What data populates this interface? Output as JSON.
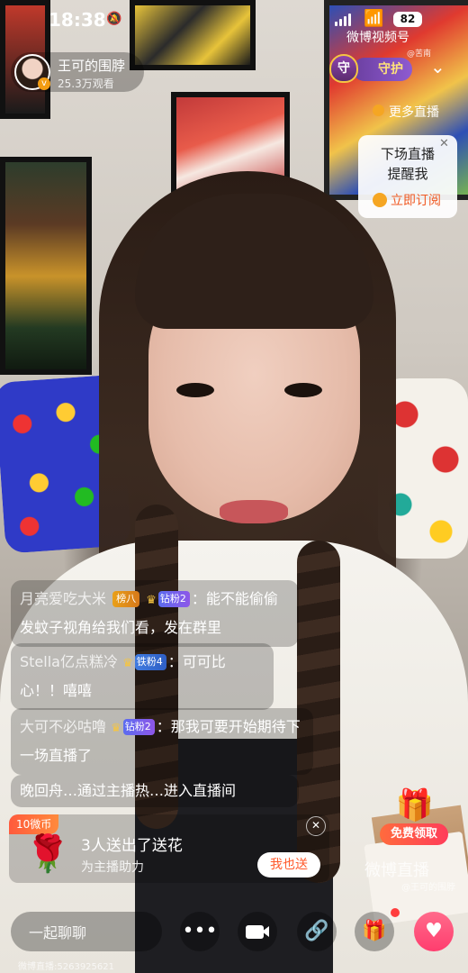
{
  "status_bar": {
    "time": "18:38",
    "battery": "82",
    "watermark": "微博视频号",
    "watermark_sub": "@苦南"
  },
  "host": {
    "name": "王可的围脖",
    "views": "25.3万观看"
  },
  "guard": {
    "label": "守护"
  },
  "more_live": {
    "label": "更多直播"
  },
  "reminder": {
    "line1": "下场直播",
    "line2": "提醒我",
    "subscribe_label": "立即订阅"
  },
  "comments": [
    {
      "user": "月亮爱吃大米",
      "rank_badge": "榜八",
      "fan_badge": "钻粉2",
      "text": "能不能偷偷发蚊子视角给我们看，发在群里"
    },
    {
      "user": "Stella亿点糕冷",
      "fan_badge": "铁粉4",
      "text": "可可比心！！嘻嘻"
    },
    {
      "user": "大可不必咕噜",
      "fan_badge": "钻粉2",
      "text": "那我可要开始期待下一场直播了"
    }
  ],
  "entry_notice": "晚回舟…通过主播热…进入直播间",
  "gift_notice": {
    "tag": "10微币",
    "title": "3人送出了送花",
    "subtitle": "为主播助力",
    "button": "我也送"
  },
  "free_gift": {
    "button": "免费领取"
  },
  "bottom_watermark": {
    "title": "微博直播",
    "sub": "@王可的围脖"
  },
  "bottom_bar": {
    "chat_placeholder": "一起聊聊",
    "footer_id": "微博直播:5263925621"
  },
  "icons": [
    "bell-mute-icon",
    "wifi-icon",
    "signal-icon",
    "verified-icon",
    "chevron-down-icon",
    "planet-icon",
    "close-icon",
    "clock-icon",
    "crown-icon",
    "rose-icon",
    "gift-box-icon",
    "more-icon",
    "camera-icon",
    "link-icon",
    "gift-icon",
    "heart-icon"
  ],
  "colors": {
    "accent_orange": "#ff5a2c",
    "heart_pink": "#ff3d6e",
    "guard_purple": "#6b3fa0"
  }
}
